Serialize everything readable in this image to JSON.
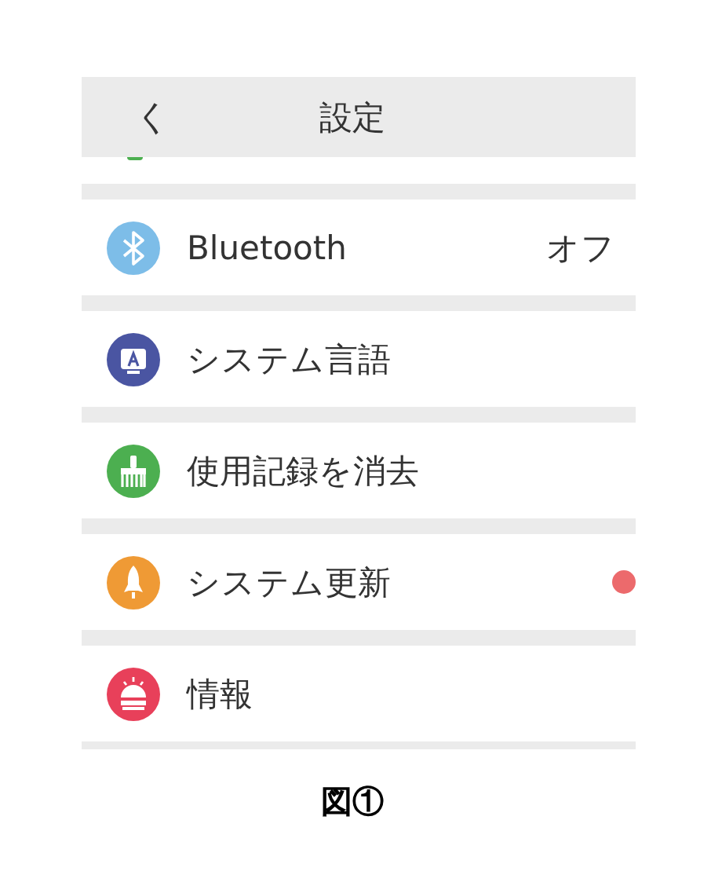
{
  "header": {
    "back": "く",
    "title": "設定"
  },
  "items": [
    {
      "label": "Bluetooth",
      "value": "オフ",
      "badge": false
    },
    {
      "label": "システム言語",
      "badge": false
    },
    {
      "label": "使用記録を消去",
      "badge": false
    },
    {
      "label": "システム更新",
      "badge": true
    },
    {
      "label": "情報",
      "badge": false
    }
  ],
  "caption": "図①"
}
